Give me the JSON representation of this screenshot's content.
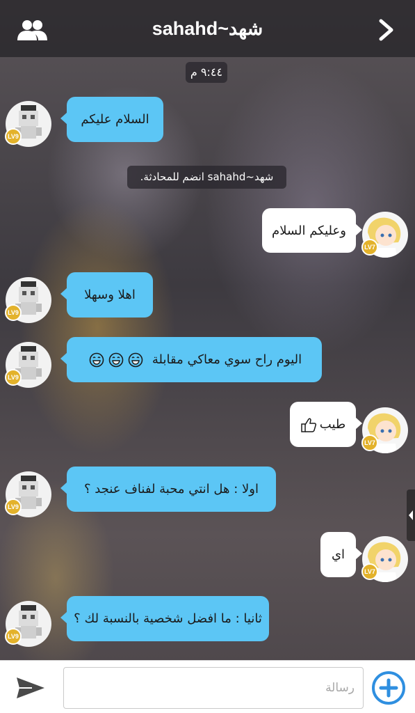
{
  "header": {
    "title": "sahahd~شهد",
    "left_icon": "users-icon",
    "right_icon": "chevron-right-icon"
  },
  "chat": {
    "time_label": "٩:٤٤ م",
    "system_notice": "شهد~sahahd انضم للمحادثة.",
    "messages": [
      {
        "side": "left",
        "text": "السلام عليكم",
        "level": "LV9"
      },
      {
        "side": "right",
        "text": "وعليكم السلام",
        "level": "LV7"
      },
      {
        "side": "left",
        "text": "اهلا وسهلا",
        "level": "LV9"
      },
      {
        "side": "left",
        "text": "اليوم راح سوي معاكي مقابلة",
        "level": "LV9",
        "emoji_count": 3
      },
      {
        "side": "right",
        "text": "طيب",
        "level": "LV7",
        "trailing_icon": "thumbs-up-icon"
      },
      {
        "side": "left",
        "text": "اولا : هل انتي محبة لفناف عنجد ؟",
        "level": "LV9"
      },
      {
        "side": "right",
        "text": "اي",
        "level": "LV7"
      },
      {
        "side": "left",
        "text": "ثانيا : ما افضل شخصية بالنسبة لك ؟",
        "level": "LV9"
      }
    ]
  },
  "composer": {
    "placeholder": "رسالة",
    "value": "",
    "send_icon": "send-icon",
    "add_icon": "plus-circle-icon"
  },
  "colors": {
    "incoming_bubble": "#5cc6f5",
    "outgoing_bubble": "#ffffff",
    "level_badge": "#e3b22b",
    "plus_button": "#2f8fe0"
  }
}
